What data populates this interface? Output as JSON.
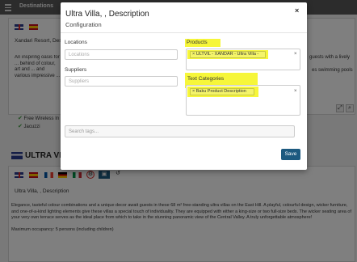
{
  "nav": {
    "destinations": "Destinations"
  },
  "background": {
    "resort_field": "Xandari Resort, Des",
    "resort_text": "An inspiring oasis for ... behind of colour, art and ... and various impressive ...",
    "right_text_1": "guests with a lively",
    "right_text_2": "es swimming pools",
    "amenity_1": "Free Wireless In",
    "amenity_2": "Jacuzzi",
    "section_title": "ULTRA VILL",
    "description_field": "Ultra Villa, , Description",
    "description_text": "Elegance, tasteful colour combinations and a unique decor await guests in these 68 m² free-standing ultra villas on the East Hill. A playful, colourful design, wicker furniture, and one-of-a-kind lighting elements give these villas a special touch of individuality. They are equipped with either a king-size or two full-size beds. The wicker seating area of your very own terrace serves as the ideal place from which to take in the stunning panoramic view of the Central Valley. A truly unforgettable atmosphere!",
    "occupancy": "Maximum occupancy: 5 persons (including children)"
  },
  "modal": {
    "title": "Ultra Villa, , Description",
    "subtitle": "Configuration",
    "close": "×",
    "locations_label": "Locations",
    "locations_placeholder": "Locations",
    "suppliers_label": "Suppliers",
    "suppliers_placeholder": "Suppliers",
    "products_label": "Products",
    "product_tag": "× ULTVIL - XANDAR - Ultra Villa -",
    "text_categories_label": "Text Categories",
    "category_tag": "× Baku Product Description",
    "clear": "×",
    "search_placeholder": "Search tags...",
    "save": "Save"
  },
  "colors": {
    "highlight": "#f6f63a",
    "save_bg": "#1d5a80",
    "nav_bg": "#595959"
  }
}
